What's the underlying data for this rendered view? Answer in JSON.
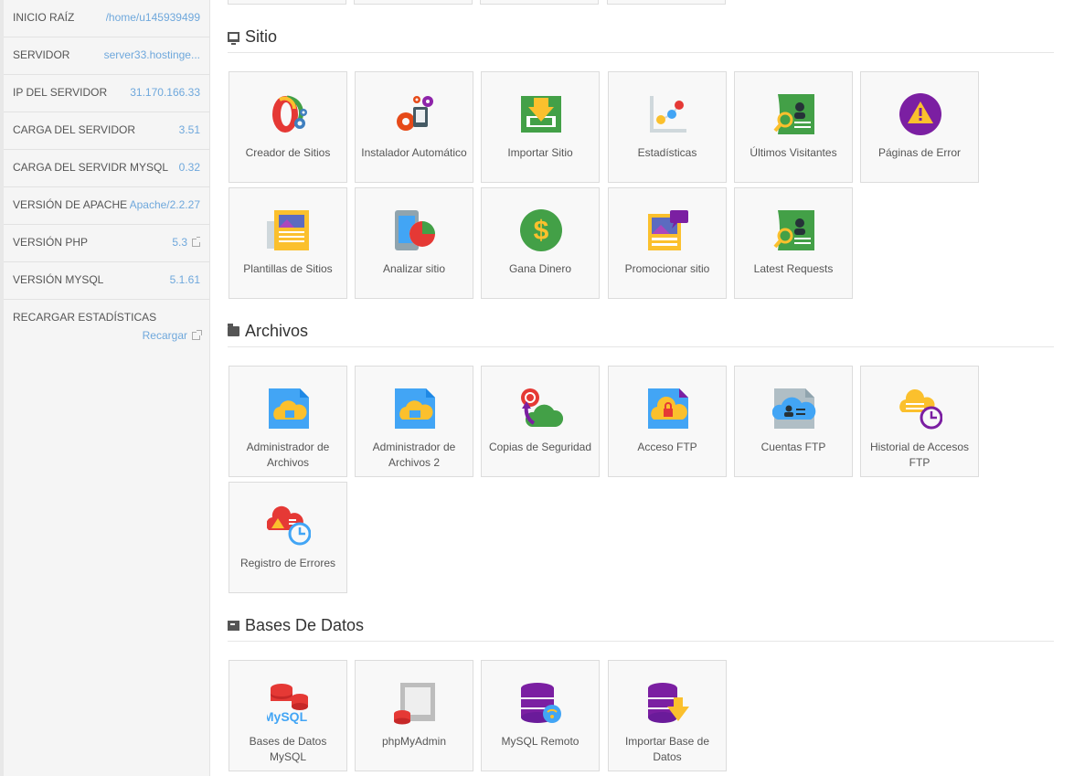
{
  "sidebar": {
    "stats": [
      {
        "label": "INICIO RAÍZ",
        "value": "/home/u145939499"
      },
      {
        "label": "SERVIDOR",
        "value": "server33.hostinge..."
      },
      {
        "label": "IP DEL SERVIDOR",
        "value": "31.170.166.33"
      },
      {
        "label": "CARGA DEL SERVIDOR",
        "value": "3.51"
      },
      {
        "label": "CARGA DEL SERVIDR MYSQL",
        "value": "0.32"
      },
      {
        "label": "VERSIÓN DE APACHE",
        "value": "Apache/2.2.27"
      },
      {
        "label": "VERSIÓN PHP",
        "value": "5.3"
      },
      {
        "label": "VERSIÓN MYSQL",
        "value": "5.1.61"
      }
    ],
    "reload": {
      "label": "RECARGAR ESTADÍSTICAS",
      "link": "Recargar"
    }
  },
  "sections": {
    "sitio": {
      "title": "Sitio",
      "items": [
        "Creador de Sitios",
        "Instalador Automático",
        "Importar Sitio",
        "Estadísticas",
        "Últimos Visitantes",
        "Páginas de Error",
        "Plantillas de Sitios",
        "Analizar sitio",
        "Gana Dinero",
        "Promocionar sitio",
        "Latest Requests"
      ]
    },
    "archivos": {
      "title": "Archivos",
      "items": [
        "Administrador de Archivos",
        "Administrador de Archivos 2",
        "Copias de Seguridad",
        "Acceso FTP",
        "Cuentas FTP",
        "Historial de Accesos FTP",
        "Registro de Errores"
      ]
    },
    "bases": {
      "title": "Bases De Datos",
      "items": [
        "Bases de Datos MySQL",
        "phpMyAdmin",
        "MySQL Remoto",
        "Importar Base de Datos"
      ]
    }
  },
  "icons": {
    "mysql_text": "MySQL",
    "dollar": "$",
    "warning": "!"
  }
}
